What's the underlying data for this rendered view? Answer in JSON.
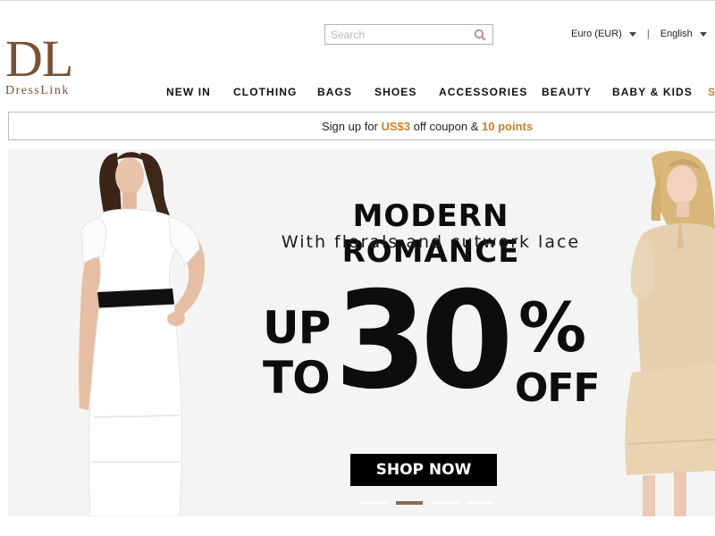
{
  "logo": {
    "mark": "DL",
    "text": "DressLink"
  },
  "search": {
    "placeholder": "Search",
    "value": ""
  },
  "top_right": {
    "currency": "Euro (EUR)",
    "language": "English",
    "separator": "|",
    "truncated_item": "S"
  },
  "nav": [
    {
      "label": "NEW IN"
    },
    {
      "label": "CLOTHING"
    },
    {
      "label": "BAGS"
    },
    {
      "label": "SHOES"
    },
    {
      "label": "ACCESSORIES"
    },
    {
      "label": "BEAUTY"
    },
    {
      "label": "BABY & KIDS"
    },
    {
      "label": "S"
    }
  ],
  "signup": {
    "prefix": "Sign up for ",
    "amount": "US$3",
    "middle": " off coupon & ",
    "points": "10 points"
  },
  "banner": {
    "headline": "MODERN ROMANCE",
    "subline": "With florals and cutwork lace",
    "up": "UP",
    "to": "TO",
    "number": "30",
    "percent": "%",
    "off": "OFF",
    "cta": "SHOP NOW",
    "slide_count": 4,
    "active_slide": 2
  },
  "colors": {
    "brand": "#7a5135",
    "accent": "#c8822e",
    "banner_bg": "#f4f4f4",
    "active_dot": "#8a6a52"
  },
  "icons": {
    "search": "search-icon",
    "caret": "chevron-down-icon"
  }
}
